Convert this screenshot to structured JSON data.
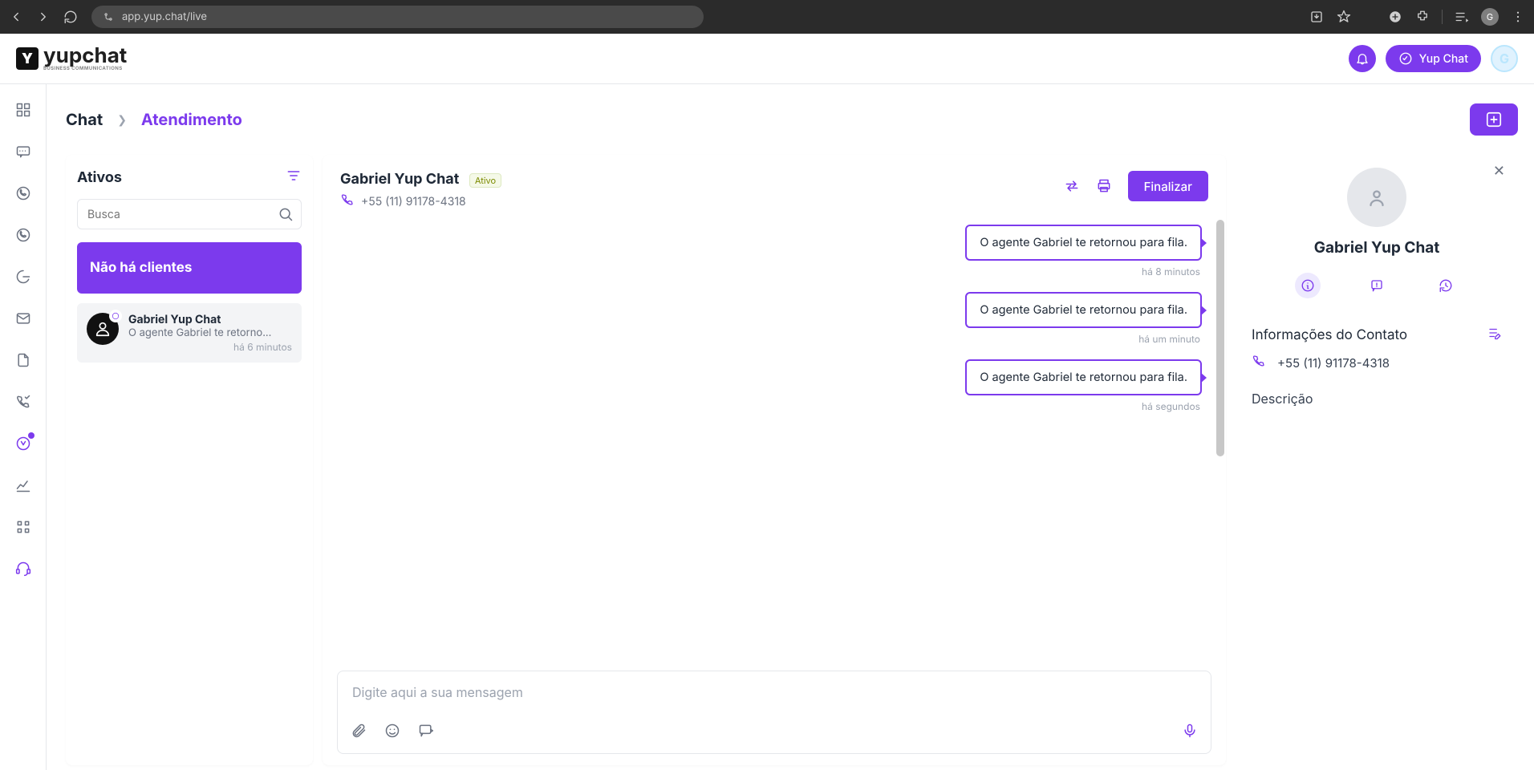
{
  "browser": {
    "url": "app.yup.chat/live",
    "avatar_letter": "G"
  },
  "topbar": {
    "brand": "yupchat",
    "brand_sub": "BUSINESS COMMUNICATIONS",
    "yup_pill": "Yup Chat",
    "avatar_letter": "G"
  },
  "breadcrumb": {
    "root": "Chat",
    "current": "Atendimento"
  },
  "left": {
    "title": "Ativos",
    "search_placeholder": "Busca",
    "no_clients": "Não há clientes",
    "item": {
      "name": "Gabriel Yup Chat",
      "preview": "O agente Gabriel te retorno...",
      "time": "há 6 minutos"
    }
  },
  "chat": {
    "name": "Gabriel Yup Chat",
    "status": "Ativo",
    "phone": "+55 (11) 91178-4318",
    "finalize": "Finalizar",
    "messages": [
      {
        "text": "O agente Gabriel te retornou para fila.",
        "time": "há 8 minutos"
      },
      {
        "text": "O agente Gabriel te retornou para fila.",
        "time": "há um minuto"
      },
      {
        "text": "O agente Gabriel te retornou para fila.",
        "time": "há segundos"
      }
    ],
    "composer_placeholder": "Digite aqui a sua mensagem"
  },
  "contact": {
    "name": "Gabriel Yup Chat",
    "info_title": "Informações do Contato",
    "phone": "+55 (11) 91178-4318",
    "desc_title": "Descrição"
  }
}
